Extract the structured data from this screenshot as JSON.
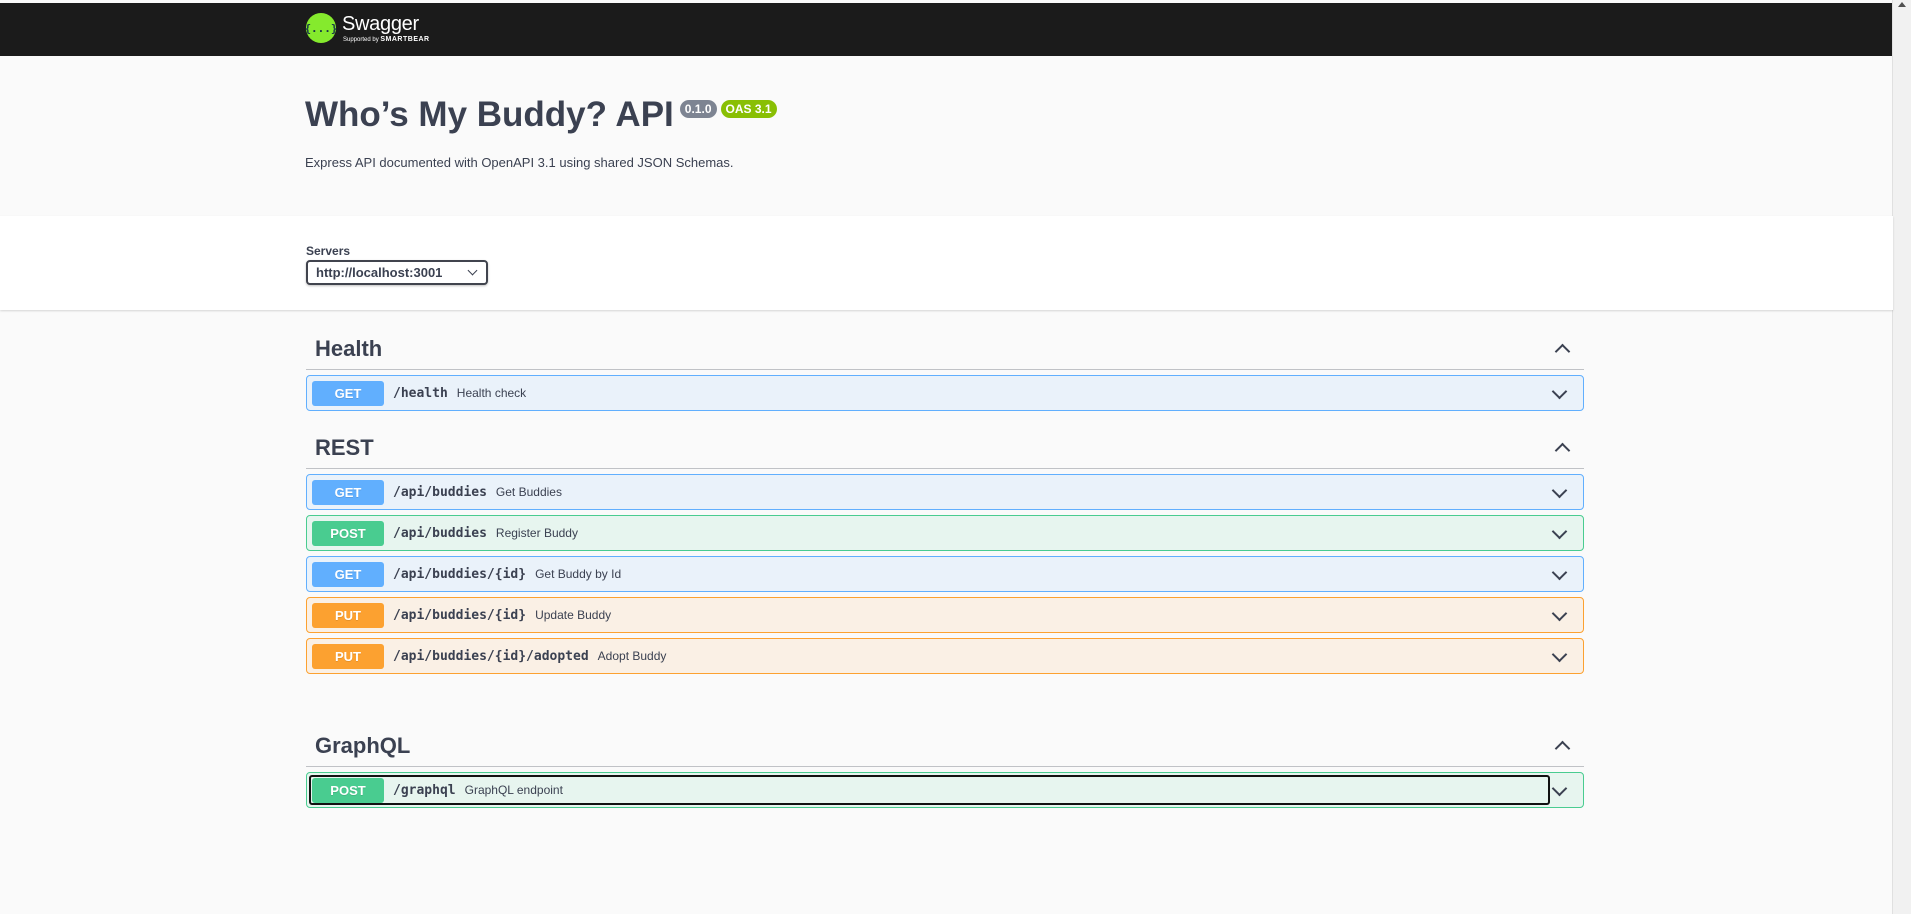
{
  "topbar": {
    "logo_glyph": "{...}",
    "logo_name": "Swagger",
    "logo_sub_prefix": "Supported by",
    "logo_sub_brand": "SMARTBEAR"
  },
  "info": {
    "title": "Who’s My Buddy? API",
    "version": "0.1.0",
    "oas": "OAS 3.1",
    "description": "Express API documented with OpenAPI 3.1 using shared JSON Schemas."
  },
  "servers": {
    "label": "Servers",
    "selected": "http://localhost:3001"
  },
  "tags": [
    {
      "name": "Health",
      "operations": [
        {
          "method": "GET",
          "path": "/health",
          "summary": "Health check"
        }
      ]
    },
    {
      "name": "REST",
      "operations": [
        {
          "method": "GET",
          "path": "/api/buddies",
          "summary": "Get Buddies"
        },
        {
          "method": "POST",
          "path": "/api/buddies",
          "summary": "Register Buddy"
        },
        {
          "method": "GET",
          "path": "/api/buddies/{id}",
          "summary": "Get Buddy by Id"
        },
        {
          "method": "PUT",
          "path": "/api/buddies/{id}",
          "summary": "Update Buddy"
        },
        {
          "method": "PUT",
          "path": "/api/buddies/{id}/adopted",
          "summary": "Adopt Buddy"
        }
      ]
    },
    {
      "name": "GraphQL",
      "operations": [
        {
          "method": "POST",
          "path": "/graphql",
          "summary": "GraphQL endpoint"
        }
      ]
    }
  ],
  "colors": {
    "get": "#61affe",
    "post": "#49cc90",
    "put": "#fca130",
    "topbar": "#1b1b1b",
    "logo": "#85ea2d"
  }
}
